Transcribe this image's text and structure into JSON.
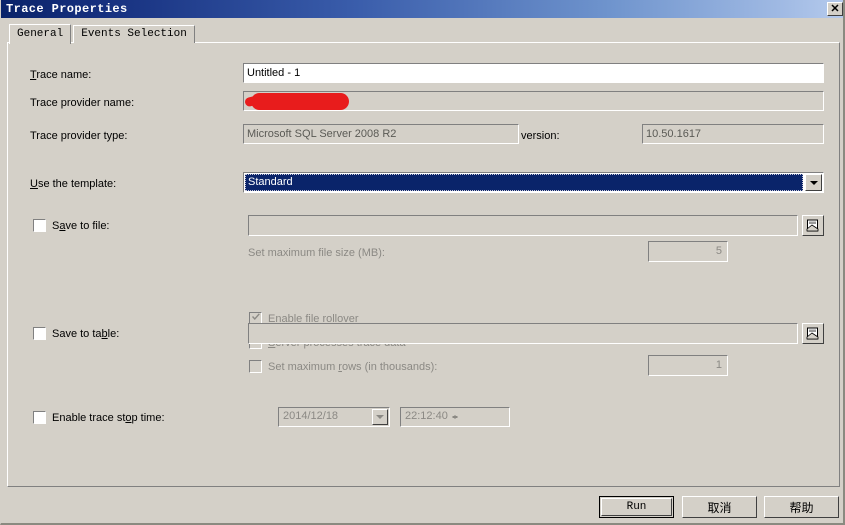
{
  "window": {
    "title": "Trace Properties",
    "close_label": "✕"
  },
  "tabs": [
    {
      "label": "General",
      "active": true
    },
    {
      "label": "Events Selection",
      "active": false
    }
  ],
  "form": {
    "trace_name": {
      "label": "Trace name:",
      "value": "Untitled - 1"
    },
    "trace_provider_name": {
      "label": "Trace provider name:",
      "value": "",
      "redacted": true
    },
    "trace_provider_type": {
      "label": "Trace provider type:",
      "value": "Microsoft SQL Server 2008 R2"
    },
    "version": {
      "label": "version:",
      "value": "10.50.1617"
    },
    "template": {
      "label": "Use the template:",
      "value": "Standard"
    },
    "save_to_file": {
      "label": "Save to file:",
      "checked": false,
      "path_value": "",
      "max_file_size": {
        "label": "Set maximum file size (MB):",
        "value": "5"
      },
      "enable_rollover": {
        "label": "Enable file rollover",
        "checked": true
      },
      "server_processes": {
        "label": "Server processes trace data",
        "checked": false
      }
    },
    "save_to_table": {
      "label": "Save to table:",
      "checked": false,
      "path_value": "",
      "max_rows": {
        "label": "Set maximum rows (in thousands):",
        "value": "1",
        "checked": false
      }
    },
    "stop_time": {
      "label": "Enable trace stop time:",
      "checked": false,
      "date_value": "2014/12/18",
      "time_value": "22:12:40"
    }
  },
  "buttons": {
    "run": "Run",
    "cancel": "取消",
    "help": "帮助"
  },
  "colors": {
    "dialog_face": "#d4d0c8",
    "title_start": "#0a246a",
    "title_end": "#b6cbed",
    "selection": "#0a246a",
    "redaction": "#e81c1c",
    "disabled_text": "#8b8984"
  }
}
